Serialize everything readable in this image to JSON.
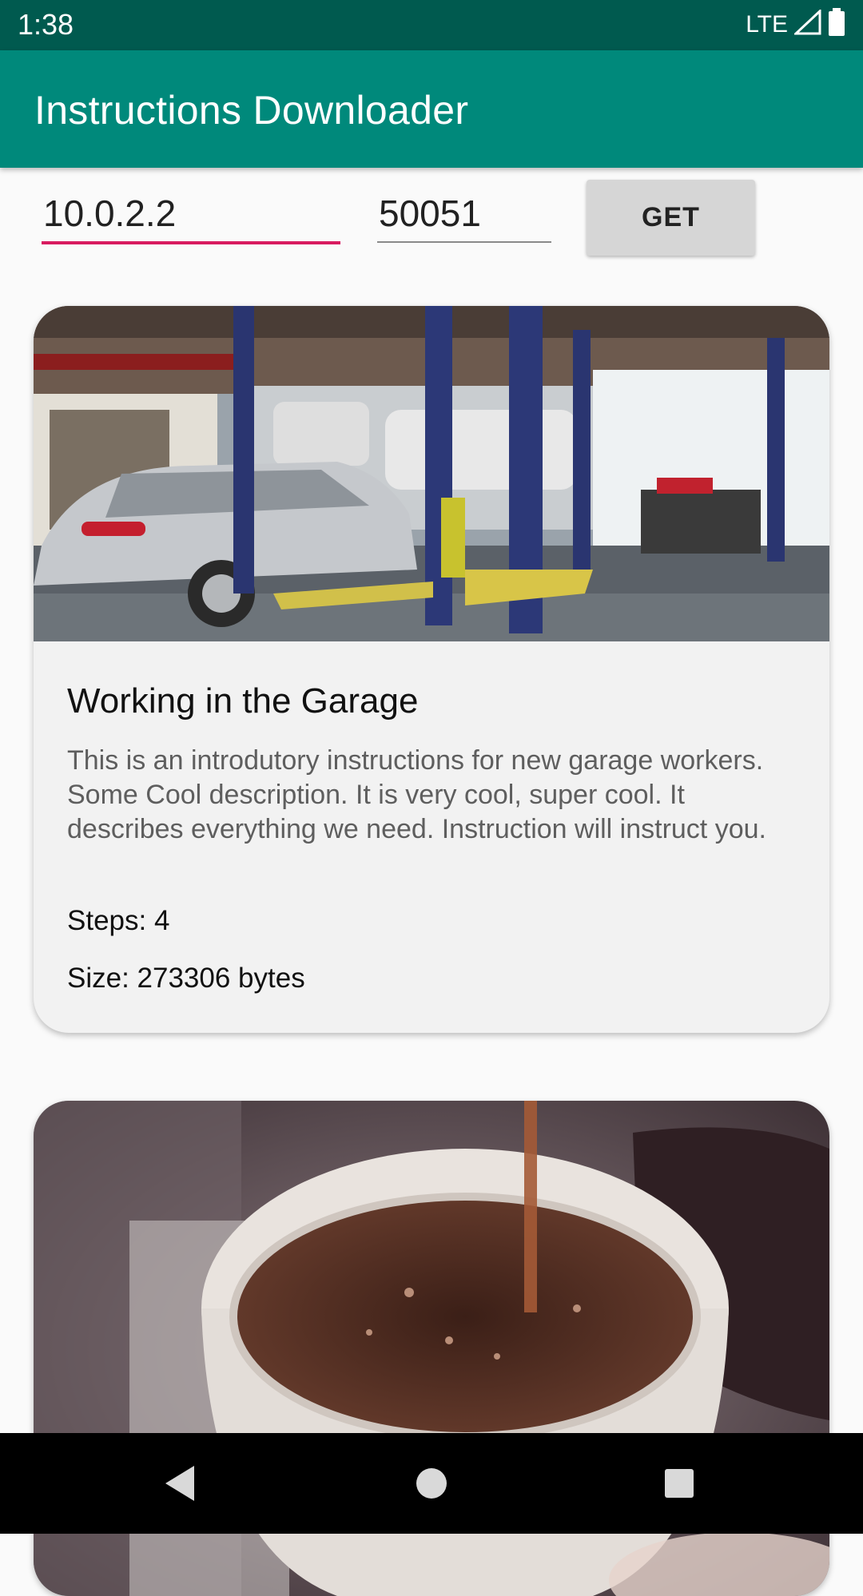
{
  "status_bar": {
    "time": "1:38",
    "network": "LTE",
    "icons": [
      "signal-icon",
      "battery-icon"
    ]
  },
  "app_bar": {
    "title": "Instructions Downloader"
  },
  "connection": {
    "host_value": "10.0.2.2",
    "port_value": "50051",
    "get_button_label": "GET"
  },
  "cards": [
    {
      "image": "garage-photo",
      "title": "Working in the Garage",
      "description": "This is an introdutory instructions for new garage workers. Some Cool description. It is very cool, super cool. It describes everything we need. Instruction will instruct you.",
      "steps": "Steps: 4",
      "size": "Size: 273306 bytes"
    },
    {
      "image": "coffee-photo"
    }
  ],
  "nav_bar": {
    "icons": [
      "back-icon",
      "home-icon",
      "recents-icon"
    ]
  },
  "colors": {
    "status_bar": "#005a4f",
    "app_bar": "#00897b",
    "accent": "#d81b60",
    "card": "#f2f2f2"
  }
}
